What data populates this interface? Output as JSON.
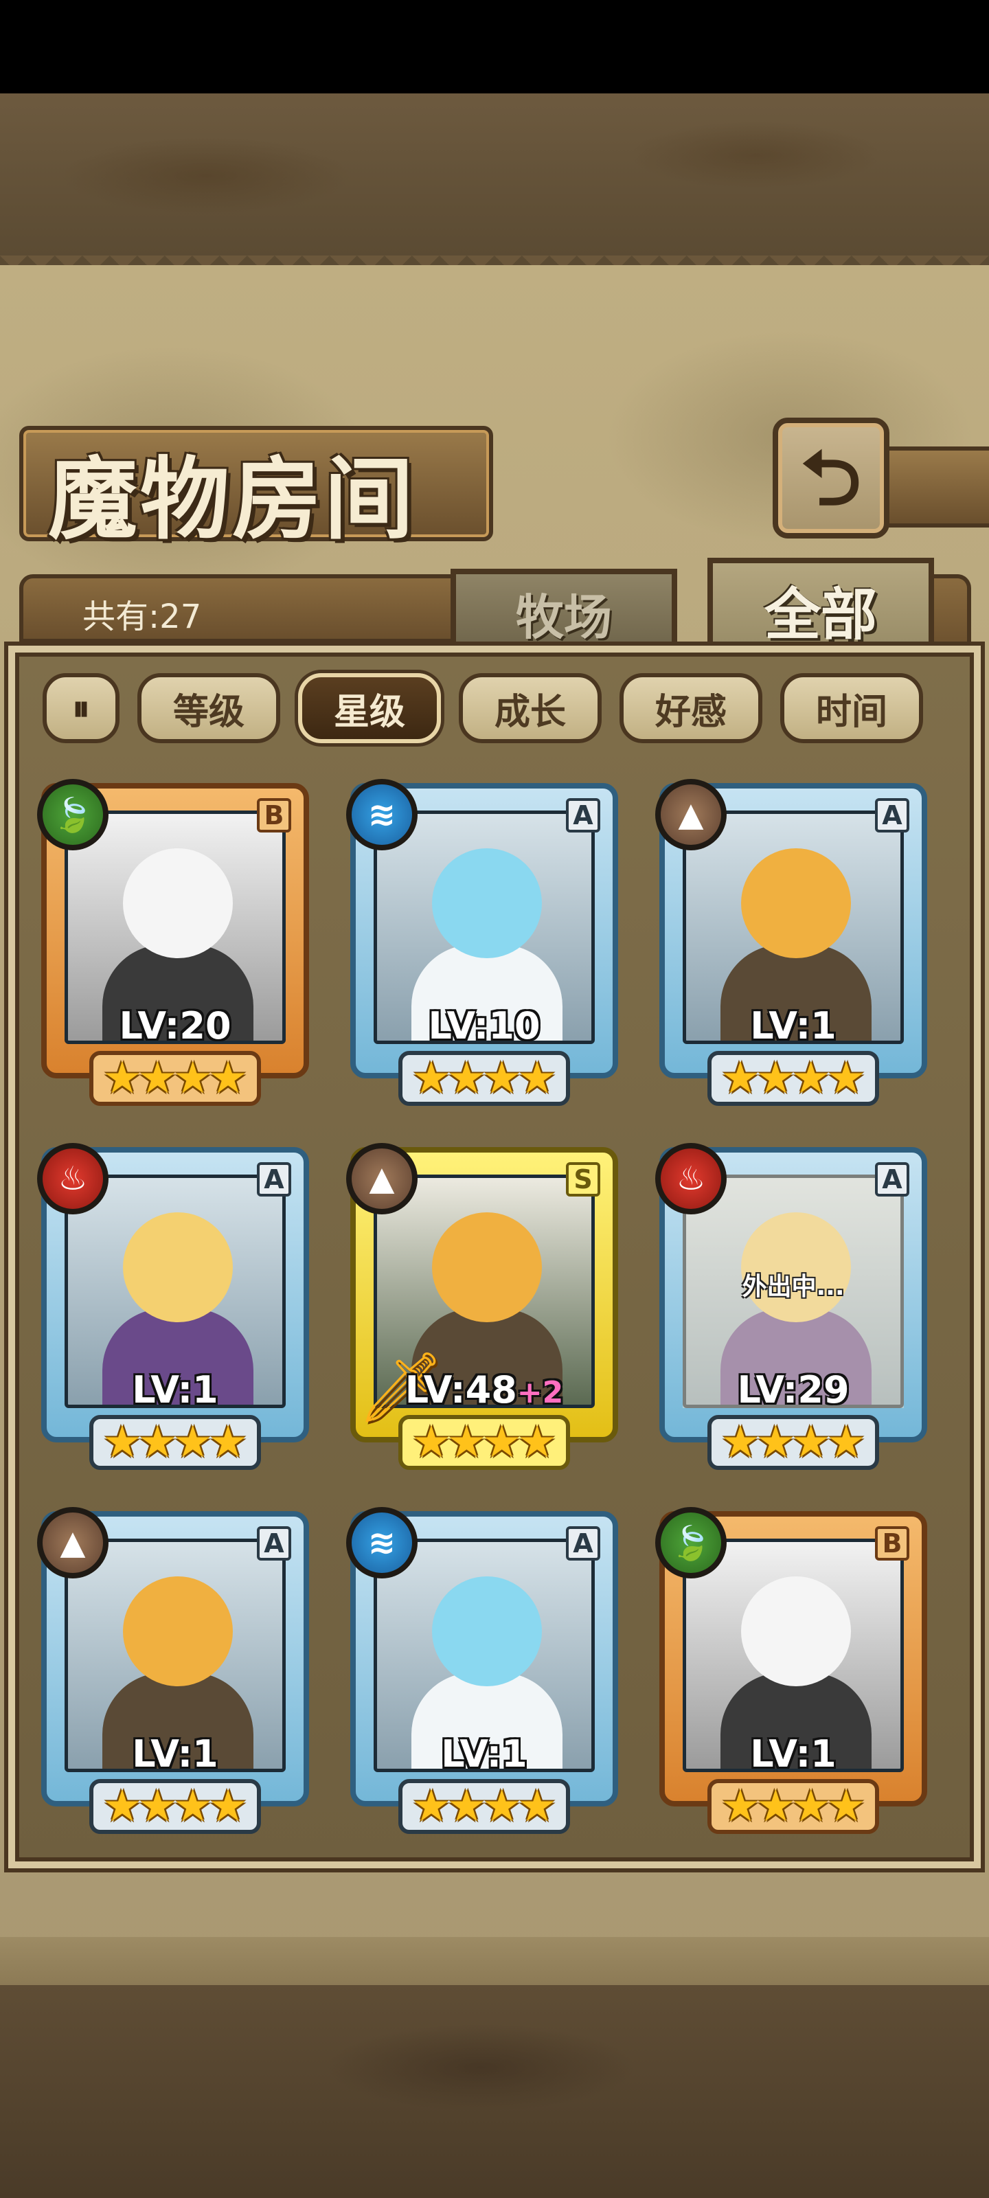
{
  "screen": {
    "title": "魔物房间",
    "back_icon": "return-arrow-icon"
  },
  "header": {
    "count_label": "共有:27"
  },
  "tabs": [
    {
      "label": "牧场",
      "active": false
    },
    {
      "label": "全部",
      "active": true
    }
  ],
  "sort": {
    "toggle_icon": "sort-order-icon",
    "toggle_glyph": "⏸",
    "buttons": [
      {
        "label": "等级",
        "active": false
      },
      {
        "label": "星级",
        "active": true
      },
      {
        "label": "成长",
        "active": false
      },
      {
        "label": "好感",
        "active": false
      },
      {
        "label": "时间",
        "active": false
      }
    ]
  },
  "monsters": [
    {
      "rank": "B",
      "element": "wind",
      "element_glyph": "🍃",
      "level": "LV:20",
      "bonus": "",
      "stars": 4,
      "status": ""
    },
    {
      "rank": "A",
      "element": "water",
      "element_glyph": "≋",
      "level": "LV:10",
      "bonus": "",
      "stars": 4,
      "status": ""
    },
    {
      "rank": "A",
      "element": "earth",
      "element_glyph": "▲",
      "level": "LV:1",
      "bonus": "",
      "stars": 4,
      "status": ""
    },
    {
      "rank": "A",
      "element": "fire",
      "element_glyph": "♨",
      "level": "LV:1",
      "bonus": "",
      "stars": 4,
      "status": ""
    },
    {
      "rank": "S",
      "element": "earth",
      "element_glyph": "▲",
      "level": "LV:48",
      "bonus": "+2",
      "stars": 4,
      "status": ""
    },
    {
      "rank": "A",
      "element": "fire",
      "element_glyph": "♨",
      "level": "LV:29",
      "bonus": "",
      "stars": 4,
      "status": "外出中..."
    },
    {
      "rank": "A",
      "element": "earth",
      "element_glyph": "▲",
      "level": "LV:1",
      "bonus": "",
      "stars": 4,
      "status": ""
    },
    {
      "rank": "A",
      "element": "water",
      "element_glyph": "≋",
      "level": "LV:1",
      "bonus": "",
      "stars": 4,
      "status": ""
    },
    {
      "rank": "B",
      "element": "wind",
      "element_glyph": "🍃",
      "level": "LV:1",
      "bonus": "",
      "stars": 4,
      "status": ""
    }
  ],
  "colors": {
    "frame_A": "#74b7d8",
    "frame_B": "#d9822e",
    "frame_S": "#e3bf16",
    "star": "#ffc21a"
  }
}
